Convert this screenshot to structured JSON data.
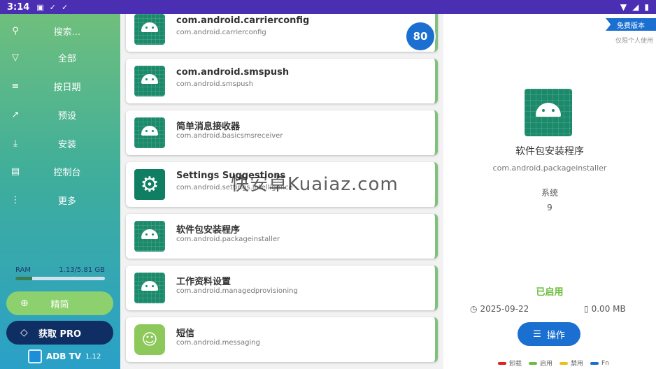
{
  "status_bar": {
    "time": "3:14"
  },
  "sidebar": {
    "search_placeholder": "搜索...",
    "items": [
      {
        "label": "全部",
        "icon": "filter-icon"
      },
      {
        "label": "按日期",
        "icon": "sort-icon"
      },
      {
        "label": "预设",
        "icon": "open-external-icon"
      },
      {
        "label": "安装",
        "icon": "download-icon"
      },
      {
        "label": "控制台",
        "icon": "terminal-icon"
      },
      {
        "label": "更多",
        "icon": "more-vert-icon"
      }
    ],
    "ram": {
      "label": "RAM",
      "value": "1.13/5.81 GB",
      "fraction": 0.19
    },
    "simple_label": "精简",
    "pro_label": "获取 PRO",
    "brand": {
      "name": "ADB TV",
      "version": "1.12"
    }
  },
  "list": {
    "badge": "80",
    "items": [
      {
        "title": "com.android.carrierconfig",
        "pkg": "com.android.carrierconfig",
        "icon": "android-icon"
      },
      {
        "title": "com.android.smspush",
        "pkg": "com.android.smspush",
        "icon": "android-icon"
      },
      {
        "title": "简单消息接收器",
        "pkg": "com.android.basicsmsreceiver",
        "icon": "android-icon"
      },
      {
        "title": "Settings Suggestions",
        "pkg": "com.android.settings.intelligence",
        "icon": "settings-gear-icon"
      },
      {
        "title": "软件包安装程序",
        "pkg": "com.android.packageinstaller",
        "icon": "android-icon"
      },
      {
        "title": "工作资料设置",
        "pkg": "com.android.managedprovisioning",
        "icon": "android-icon"
      },
      {
        "title": "短信",
        "pkg": "com.android.messaging",
        "icon": "message-icon"
      }
    ]
  },
  "detail": {
    "ribbon": "免费版本",
    "personal": "仅限个人使用",
    "name": "软件包安装程序",
    "pkg": "com.android.packageinstaller",
    "type": "系统",
    "version": "9",
    "status": "已启用",
    "date": "2025-09-22",
    "size": "0.00 MB",
    "op_label": "操作",
    "legend": [
      {
        "label": "卸载",
        "color": "#e02020"
      },
      {
        "label": "启用",
        "color": "#6cbd3e"
      },
      {
        "label": "禁用",
        "color": "#e8c21a"
      },
      {
        "label": "Fn",
        "color": "#1a6fd1"
      }
    ]
  },
  "watermark": "快安卓Kuaiaz.com"
}
